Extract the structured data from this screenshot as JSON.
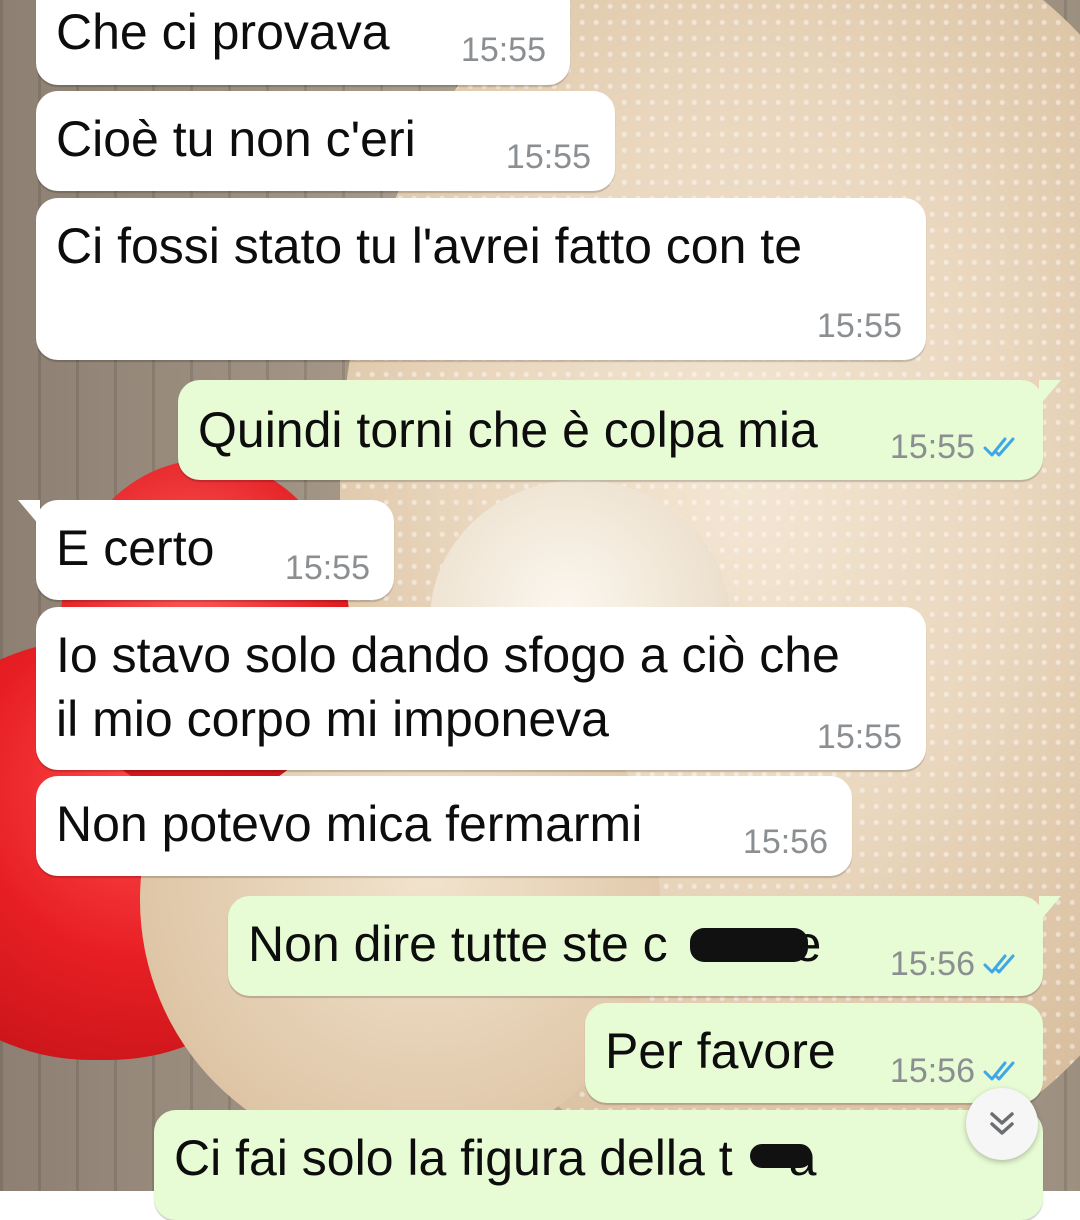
{
  "messages": [
    {
      "direction": "in",
      "text": "Che ci provava",
      "time": "15:55"
    },
    {
      "direction": "in",
      "text": "Cioè tu non c'eri",
      "time": "15:55"
    },
    {
      "direction": "in",
      "text": "Ci fossi stato tu l'avrei fatto con te",
      "time": "15:55"
    },
    {
      "direction": "out",
      "text": "Quindi torni che è colpa mia",
      "time": "15:55",
      "status": "read"
    },
    {
      "direction": "in",
      "text": "E certo",
      "time": "15:55"
    },
    {
      "direction": "in",
      "text_line1": "Io stavo solo dando sfogo a ciò che",
      "text_line2": "il mio corpo mi imponeva",
      "time": "15:55"
    },
    {
      "direction": "in",
      "text": "Non potevo mica fermarmi",
      "time": "15:56"
    },
    {
      "direction": "out",
      "text": "Non dire tutte ste c",
      "text_end": "te",
      "time": "15:56",
      "status": "read",
      "redacted": true
    },
    {
      "direction": "out",
      "text": "Per favore",
      "time": "15:56",
      "status": "read"
    },
    {
      "direction": "out",
      "text": "Ci fai solo la figura della t",
      "text_end": "a",
      "redacted": true
    }
  ],
  "colors": {
    "incoming_bubble": "#ffffff",
    "outgoing_bubble": "#e7fbd4",
    "read_ticks": "#3ea8e6",
    "timestamp": "#8b8f92"
  },
  "icons": {
    "read_status": "double-check-icon",
    "scroll_down": "double-chevron-down-icon"
  }
}
